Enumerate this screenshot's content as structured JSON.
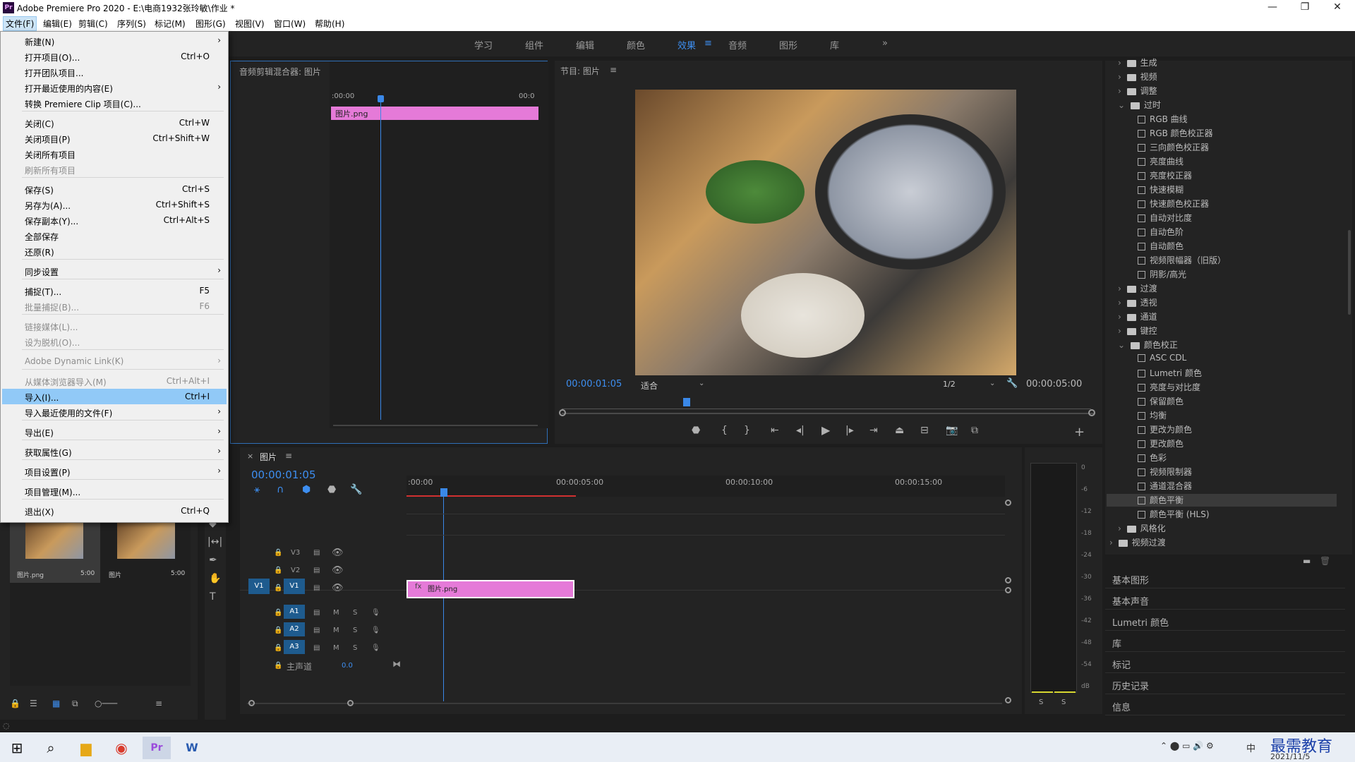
{
  "window": {
    "title": "Adobe Premiere Pro 2020 - E:\\电商1932张玲敏\\作业 *",
    "min": "—",
    "max": "❐",
    "close": "✕",
    "logo": "Pr"
  },
  "menubar": [
    "文件(F)",
    "编辑(E)",
    "剪辑(C)",
    "序列(S)",
    "标记(M)",
    "图形(G)",
    "视图(V)",
    "窗口(W)",
    "帮助(H)"
  ],
  "workspaces": [
    "学习",
    "组件",
    "编辑",
    "颜色",
    "效果",
    "音频",
    "图形",
    "库"
  ],
  "ws_more": "»",
  "ws_menu": "≡",
  "file_menu": [
    {
      "label": "新建(N)",
      "sc": "",
      "arrow": true
    },
    {
      "label": "打开项目(O)...",
      "sc": "Ctrl+O"
    },
    {
      "label": "打开团队项目..."
    },
    {
      "label": "打开最近使用的内容(E)",
      "arrow": true
    },
    {
      "label": "转换 Premiere Clip 项目(C)..."
    },
    {
      "label": "关闭(C)",
      "sc": "Ctrl+W"
    },
    {
      "label": "关闭项目(P)",
      "sc": "Ctrl+Shift+W"
    },
    {
      "label": "关闭所有项目"
    },
    {
      "label": "刷新所有项目",
      "dis": true
    },
    {
      "label": "保存(S)",
      "sc": "Ctrl+S"
    },
    {
      "label": "另存为(A)...",
      "sc": "Ctrl+Shift+S"
    },
    {
      "label": "保存副本(Y)...",
      "sc": "Ctrl+Alt+S"
    },
    {
      "label": "全部保存"
    },
    {
      "label": "还原(R)"
    },
    {
      "label": "同步设置",
      "arrow": true
    },
    {
      "label": "捕捉(T)...",
      "sc": "F5"
    },
    {
      "label": "批量捕捉(B)...",
      "sc": "F6",
      "dis": true
    },
    {
      "label": "链接媒体(L)...",
      "dis": true
    },
    {
      "label": "设为脱机(O)...",
      "dis": true
    },
    {
      "label": "Adobe Dynamic Link(K)",
      "arrow": true,
      "dis": true
    },
    {
      "label": "从媒体浏览器导入(M)",
      "sc": "Ctrl+Alt+I",
      "dis": true
    },
    {
      "label": "导入(I)...",
      "sc": "Ctrl+I",
      "hi": true
    },
    {
      "label": "导入最近使用的文件(F)",
      "arrow": true
    },
    {
      "label": "导出(E)",
      "arrow": true
    },
    {
      "label": "获取属性(G)",
      "arrow": true
    },
    {
      "label": "项目设置(P)",
      "arrow": true
    },
    {
      "label": "项目管理(M)..."
    },
    {
      "label": "退出(X)",
      "sc": "Ctrl+Q"
    }
  ],
  "audio_mixer": {
    "title": "音频剪辑混合器: 图片",
    "tc_start": ":00:00",
    "tc_end": "00:0",
    "clip": "图片.png"
  },
  "program": {
    "title": "节目: 图片",
    "menu": "≡",
    "timecode": "00:00:01:05",
    "fit": "适合",
    "res": "1/2",
    "duration": "00:00:05:00"
  },
  "effects": {
    "rows": [
      {
        "t": "folder",
        "label": "生成",
        "lvl": 1,
        "open": false
      },
      {
        "t": "folder",
        "label": "视频",
        "lvl": 1,
        "open": false
      },
      {
        "t": "folder",
        "label": "调整",
        "lvl": 1,
        "open": false
      },
      {
        "t": "folder",
        "label": "过时",
        "lvl": 1,
        "open": true
      },
      {
        "t": "fx",
        "label": "RGB 曲线"
      },
      {
        "t": "fx",
        "label": "RGB 颜色校正器"
      },
      {
        "t": "fx",
        "label": "三向颜色校正器"
      },
      {
        "t": "fx",
        "label": "亮度曲线"
      },
      {
        "t": "fx",
        "label": "亮度校正器"
      },
      {
        "t": "fx",
        "label": "快速模糊"
      },
      {
        "t": "fx",
        "label": "快速颜色校正器"
      },
      {
        "t": "fx",
        "label": "自动对比度"
      },
      {
        "t": "fx",
        "label": "自动色阶"
      },
      {
        "t": "fx",
        "label": "自动颜色"
      },
      {
        "t": "fx",
        "label": "视频限幅器（旧版）"
      },
      {
        "t": "fx",
        "label": "阴影/高光"
      },
      {
        "t": "folder",
        "label": "过渡",
        "lvl": 1,
        "open": false
      },
      {
        "t": "folder",
        "label": "透视",
        "lvl": 1,
        "open": false
      },
      {
        "t": "folder",
        "label": "通道",
        "lvl": 1,
        "open": false
      },
      {
        "t": "folder",
        "label": "键控",
        "lvl": 1,
        "open": false
      },
      {
        "t": "folder",
        "label": "颜色校正",
        "lvl": 1,
        "open": true
      },
      {
        "t": "fx",
        "label": "ASC CDL"
      },
      {
        "t": "fx",
        "label": "Lumetri 颜色"
      },
      {
        "t": "fx",
        "label": "亮度与对比度"
      },
      {
        "t": "fx",
        "label": "保留颜色"
      },
      {
        "t": "fx",
        "label": "均衡"
      },
      {
        "t": "fx",
        "label": "更改为颜色"
      },
      {
        "t": "fx",
        "label": "更改颜色"
      },
      {
        "t": "fx",
        "label": "色彩"
      },
      {
        "t": "fx",
        "label": "视频限制器"
      },
      {
        "t": "fx",
        "label": "通道混合器"
      },
      {
        "t": "fx",
        "label": "颜色平衡",
        "sel": true
      },
      {
        "t": "fx",
        "label": "颜色平衡 (HLS)"
      },
      {
        "t": "folder",
        "label": "风格化",
        "lvl": 1,
        "open": false
      },
      {
        "t": "folder",
        "label": "视频过渡",
        "lvl": 0,
        "open": false
      }
    ],
    "sections": [
      "基本图形",
      "基本声音",
      "Lumetri 颜色",
      "库",
      "标记",
      "历史记录",
      "信息"
    ]
  },
  "timeline": {
    "tab": "图片",
    "menu": "≡",
    "close": "×",
    "timecode": "00:00:01:05",
    "ruler": [
      ":00:00",
      "00:00:05:00",
      "00:00:10:00",
      "00:00:15:00"
    ],
    "video_tracks": [
      "V3",
      "V2",
      "V1"
    ],
    "audio_tracks": [
      "A1",
      "A2",
      "A3"
    ],
    "master": "主声道",
    "master_val": "0.0",
    "clip": "图片.png",
    "m": "M",
    "s": "S",
    "v1src": "V1"
  },
  "meter": {
    "labels": [
      "0",
      "-6",
      "-12",
      "-18",
      "-24",
      "-30",
      "-36",
      "-42",
      "-48",
      "-54",
      "dB"
    ],
    "s": "S"
  },
  "project": {
    "items": [
      {
        "name": "图片.png",
        "dur": "5:00"
      },
      {
        "name": "图片",
        "dur": "5:00"
      }
    ]
  },
  "taskbar": {
    "date": "2021/11/5",
    "watermark": "最需教育",
    "ime": "中"
  }
}
